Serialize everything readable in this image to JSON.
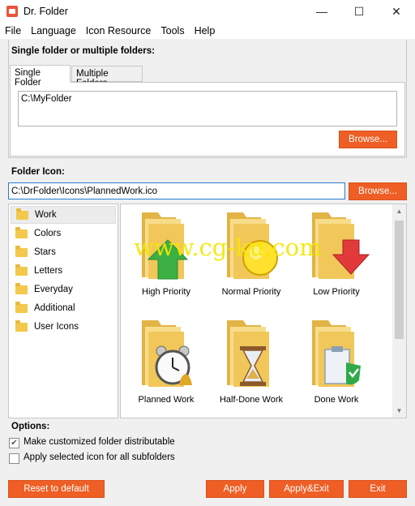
{
  "window": {
    "title": "Dr. Folder",
    "minimize": "—",
    "maximize": "☐",
    "close": "✕"
  },
  "menu": [
    "File",
    "Language",
    "Icon Resource",
    "Tools",
    "Help"
  ],
  "target": {
    "heading": "Single folder or multiple folders:",
    "tabs": [
      "Single Folder",
      "Multiple Folders"
    ],
    "active_tab": "Single Folder",
    "folder_value": "C:\\MyFolder",
    "browse_label": "Browse..."
  },
  "folder_icon": {
    "heading": "Folder Icon:",
    "path_value": "C:\\DrFolder\\Icons\\PlannedWork.ico",
    "browse_label": "Browse..."
  },
  "categories": [
    "Work",
    "Colors",
    "Stars",
    "Letters",
    "Everyday",
    "Additional",
    "User Icons"
  ],
  "selected_category": "Work",
  "icons": [
    {
      "label": "High Priority",
      "icon": "folder-green-up-arrow-icon"
    },
    {
      "label": "Normal Priority",
      "icon": "folder-yellow-circle-icon"
    },
    {
      "label": "Low Priority",
      "icon": "folder-red-down-arrow-icon"
    },
    {
      "label": "Planned Work",
      "icon": "folder-alarm-clock-icon"
    },
    {
      "label": "Half-Done Work",
      "icon": "folder-hourglass-icon"
    },
    {
      "label": "Done Work",
      "icon": "folder-clipboard-check-icon"
    }
  ],
  "watermark": "www.cg-ku.com",
  "options": {
    "heading": "Options:",
    "items": [
      {
        "label": "Make customized folder distributable",
        "checked": true
      },
      {
        "label": "Apply selected icon for all subfolders",
        "checked": false
      }
    ]
  },
  "buttons": {
    "reset": "Reset to default",
    "apply": "Apply",
    "apply_exit": "Apply&Exit",
    "exit": "Exit"
  },
  "colors": {
    "accent": "#ee5e25",
    "folder": "#f2c94c",
    "watermark": "#f5e800"
  }
}
